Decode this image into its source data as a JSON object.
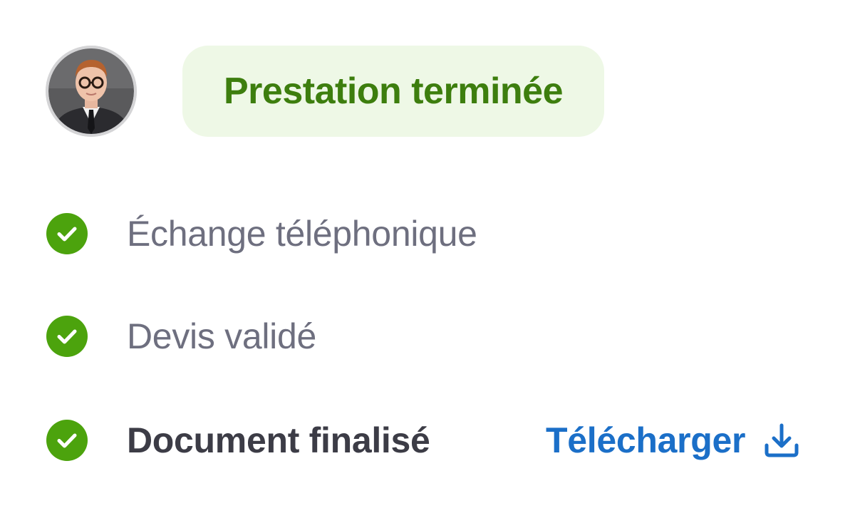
{
  "header": {
    "avatar_icon": "person-avatar",
    "status_label": "Prestation terminée",
    "status_colors": {
      "background": "#eef8e6",
      "text": "#3d7e0e"
    }
  },
  "steps": [
    {
      "label": "Échange téléphonique",
      "state": "done",
      "icon": "check-circle-icon"
    },
    {
      "label": "Devis validé",
      "state": "done",
      "icon": "check-circle-icon"
    },
    {
      "label": "Document finalisé",
      "state": "done",
      "icon": "check-circle-icon"
    }
  ],
  "download": {
    "label": "Télécharger",
    "icon": "download-icon",
    "color": "#1b6fc8"
  },
  "colors": {
    "check": "#4ca30d",
    "muted_text": "#6e6f7f",
    "strong_text": "#3c3c46"
  }
}
